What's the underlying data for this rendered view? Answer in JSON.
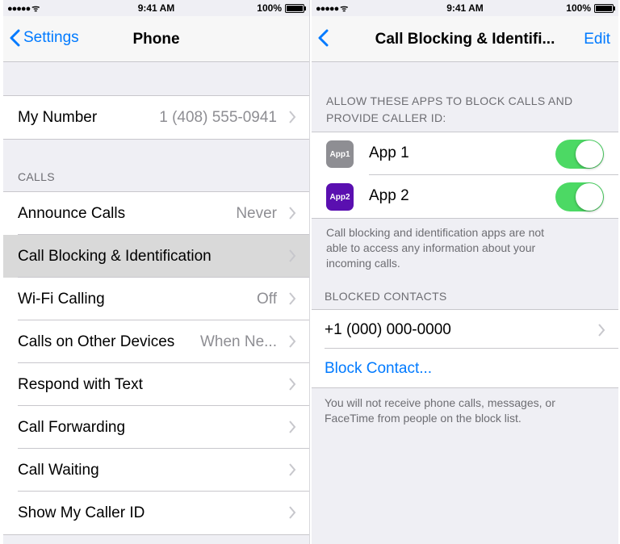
{
  "left_screen": {
    "status": {
      "signal": "●●●●● ᯤ",
      "time": "9:41 AM",
      "battery": "100%"
    },
    "nav": {
      "back_label": "Settings",
      "title": "Phone"
    },
    "my_number": {
      "label": "My Number",
      "value": "1 (408) 555-0941"
    },
    "calls_header": "CALLS",
    "rows": [
      {
        "label": "Announce Calls",
        "value": "Never"
      },
      {
        "label": "Call Blocking & Identification",
        "value": ""
      },
      {
        "label": "Wi-Fi Calling",
        "value": "Off"
      },
      {
        "label": "Calls on Other Devices",
        "value": "When Ne..."
      },
      {
        "label": "Respond with Text",
        "value": ""
      },
      {
        "label": "Call Forwarding",
        "value": ""
      },
      {
        "label": "Call Waiting",
        "value": ""
      },
      {
        "label": "Show My Caller ID",
        "value": ""
      }
    ]
  },
  "right_screen": {
    "status": {
      "signal": "●●●●● ᯤ",
      "time": "9:41 AM",
      "battery": "100%"
    },
    "nav": {
      "title": "Call Blocking & Identifi...",
      "edit_label": "Edit"
    },
    "apps_header_line1": "ALLOW THESE APPS TO BLOCK CALLS AND",
    "apps_header_line2": "PROVIDE CALLER ID:",
    "apps": [
      {
        "icon_label": "App1",
        "name": "App 1",
        "icon_color": "#8e8e93",
        "enabled": true
      },
      {
        "icon_label": "App2",
        "name": "App 2",
        "icon_color": "#5a0fb0",
        "enabled": true
      }
    ],
    "apps_footer_line1": "Call blocking and identification apps are not",
    "apps_footer_line2": "able to access any information about your",
    "apps_footer_line3": "incoming calls.",
    "blocked_header": "BLOCKED CONTACTS",
    "blocked_contacts": [
      {
        "number": "+1 (000) 000-0000"
      }
    ],
    "block_contact_label": "Block Contact...",
    "blocked_footer_line1": "You will not receive phone calls, messages, or",
    "blocked_footer_line2": "FaceTime from people on the block list."
  },
  "colors": {
    "accent": "#007aff",
    "toggle_on": "#4cd964",
    "background": "#efeff4",
    "selected_row": "#d9d9d9"
  }
}
